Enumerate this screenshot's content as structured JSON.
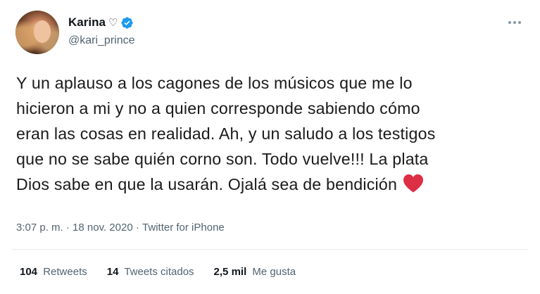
{
  "author": {
    "display_name": "Karina",
    "name_suffix_icon": "outline-heart-icon",
    "verified_icon": "verified-badge-icon",
    "handle": "@kari_prince",
    "avatar": "avatar-photo"
  },
  "tweet": {
    "lines": [
      "Y un aplauso a los cagones de los músicos que me lo",
      "hicieron a mi y no a quien corresponde sabiendo cómo",
      "eran las cosas en realidad. Ah, y un saludo a los testigos",
      "que no se sabe quién corno son. Todo vuelve!!! La plata",
      "Dios sabe en que la usarán. Ojalá sea de bendición"
    ],
    "trailing_emoji": "red-heart-icon"
  },
  "meta": {
    "time": "3:07 p. m.",
    "separator": " · ",
    "date": "18 nov. 2020",
    "source": "Twitter for iPhone"
  },
  "stats": {
    "retweets": {
      "count": "104",
      "label": "Retweets"
    },
    "quotes": {
      "count": "14",
      "label": "Tweets citados"
    },
    "likes": {
      "count": "2,5 mil",
      "label": "Me gusta"
    }
  },
  "colors": {
    "verified_blue": "#1d9bf0",
    "heart_red": "#e0245e",
    "secondary_text": "#536471"
  }
}
